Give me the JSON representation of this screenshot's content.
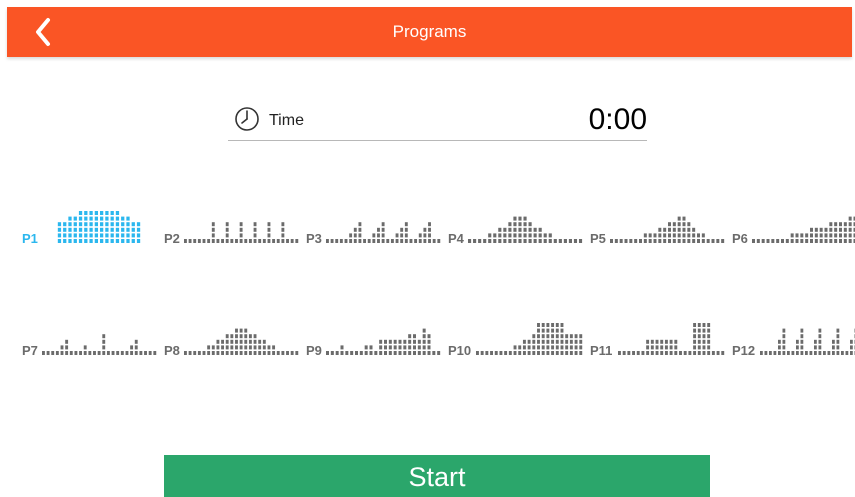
{
  "header": {
    "title": "Programs",
    "back_icon": "chevron-left-icon"
  },
  "time": {
    "icon": "clock-icon",
    "label": "Time",
    "value": "0:00"
  },
  "colors": {
    "header_bg": "#fa5525",
    "selected": "#2bb7ee",
    "unselected": "#6b6b6b",
    "start_bg": "#2ba66b"
  },
  "programs": [
    {
      "label": "P1",
      "selected": true,
      "profile": [
        0,
        0,
        0,
        4,
        4,
        5,
        5,
        6,
        6,
        6,
        6,
        6,
        6,
        6,
        6,
        5,
        5,
        4,
        4,
        0,
        0,
        0
      ]
    },
    {
      "label": "P2",
      "selected": false,
      "profile": [
        1,
        1,
        1,
        1,
        1,
        1,
        4,
        1,
        1,
        4,
        1,
        1,
        4,
        1,
        1,
        4,
        1,
        1,
        4,
        1,
        1,
        4,
        1,
        1,
        1
      ]
    },
    {
      "label": "P3",
      "selected": false,
      "profile": [
        1,
        1,
        1,
        1,
        1,
        2,
        3,
        4,
        1,
        1,
        2,
        3,
        4,
        1,
        1,
        2,
        3,
        4,
        1,
        1,
        2,
        3,
        4,
        1,
        1
      ]
    },
    {
      "label": "P4",
      "selected": false,
      "profile": [
        1,
        1,
        1,
        1,
        2,
        2,
        3,
        3,
        4,
        5,
        5,
        5,
        4,
        3,
        3,
        2,
        2,
        1,
        1,
        1,
        1,
        1,
        1
      ]
    },
    {
      "label": "P5",
      "selected": false,
      "profile": [
        1,
        1,
        1,
        1,
        1,
        1,
        1,
        2,
        2,
        2,
        3,
        3,
        4,
        4,
        5,
        5,
        4,
        3,
        2,
        2,
        1,
        1,
        1,
        1
      ]
    },
    {
      "label": "P6",
      "selected": false,
      "profile": [
        1,
        1,
        1,
        1,
        1,
        1,
        1,
        1,
        2,
        2,
        2,
        2,
        3,
        3,
        3,
        3,
        4,
        4,
        4,
        4,
        5,
        5,
        5,
        5
      ]
    },
    {
      "label": "P7",
      "selected": false,
      "profile": [
        1,
        1,
        1,
        1,
        2,
        3,
        1,
        1,
        1,
        2,
        1,
        1,
        1,
        4,
        1,
        1,
        1,
        1,
        1,
        2,
        3,
        1,
        1,
        1,
        1
      ]
    },
    {
      "label": "P8",
      "selected": false,
      "profile": [
        1,
        1,
        1,
        1,
        1,
        2,
        2,
        3,
        3,
        4,
        4,
        5,
        5,
        5,
        4,
        4,
        3,
        3,
        2,
        2,
        1,
        1,
        1,
        1,
        1
      ]
    },
    {
      "label": "P9",
      "selected": false,
      "profile": [
        1,
        1,
        1,
        2,
        1,
        1,
        1,
        1,
        2,
        2,
        1,
        3,
        3,
        3,
        3,
        3,
        3,
        4,
        4,
        3,
        5,
        4,
        1,
        1
      ]
    },
    {
      "label": "P10",
      "selected": false,
      "profile": [
        1,
        1,
        1,
        1,
        1,
        1,
        1,
        1,
        2,
        2,
        3,
        3,
        4,
        6,
        6,
        6,
        6,
        6,
        6,
        4,
        4,
        4,
        4
      ]
    },
    {
      "label": "P11",
      "selected": false,
      "profile": [
        1,
        1,
        1,
        1,
        1,
        1,
        3,
        3,
        3,
        3,
        3,
        3,
        3,
        1,
        1,
        1,
        6,
        6,
        6,
        6,
        1,
        1,
        1
      ]
    },
    {
      "label": "P12",
      "selected": false,
      "profile": [
        1,
        1,
        1,
        1,
        3,
        5,
        1,
        1,
        3,
        5,
        1,
        1,
        3,
        5,
        1,
        1,
        3,
        5,
        1,
        1,
        3,
        5,
        1,
        1
      ]
    }
  ],
  "start": {
    "label": "Start"
  }
}
